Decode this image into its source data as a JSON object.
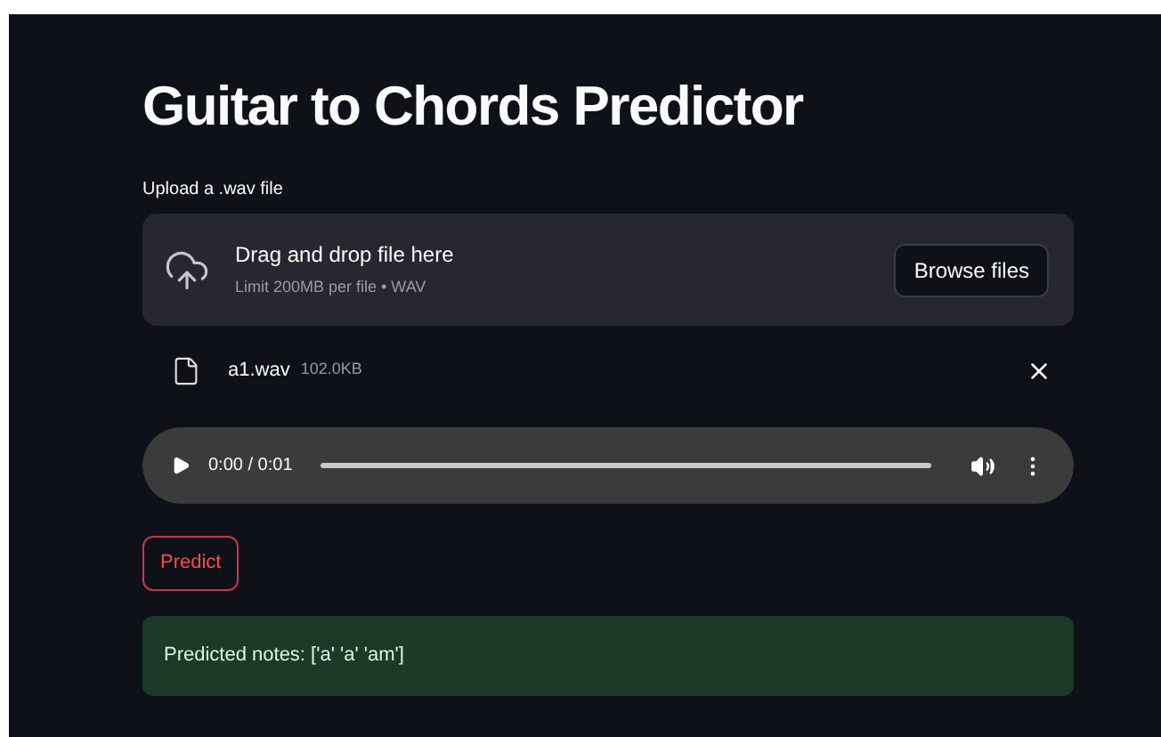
{
  "title": "Guitar to Chords Predictor",
  "uploader": {
    "label": "Upload a .wav file",
    "drop_text": "Drag and drop file here",
    "limit_text": "Limit 200MB per file • WAV",
    "browse_button": "Browse files"
  },
  "file": {
    "name": "a1.wav",
    "size": "102.0KB"
  },
  "audio": {
    "time": "0:00 / 0:01"
  },
  "predict_button": "Predict",
  "result": {
    "text": "Predicted notes: ['a' 'a' 'am']"
  }
}
